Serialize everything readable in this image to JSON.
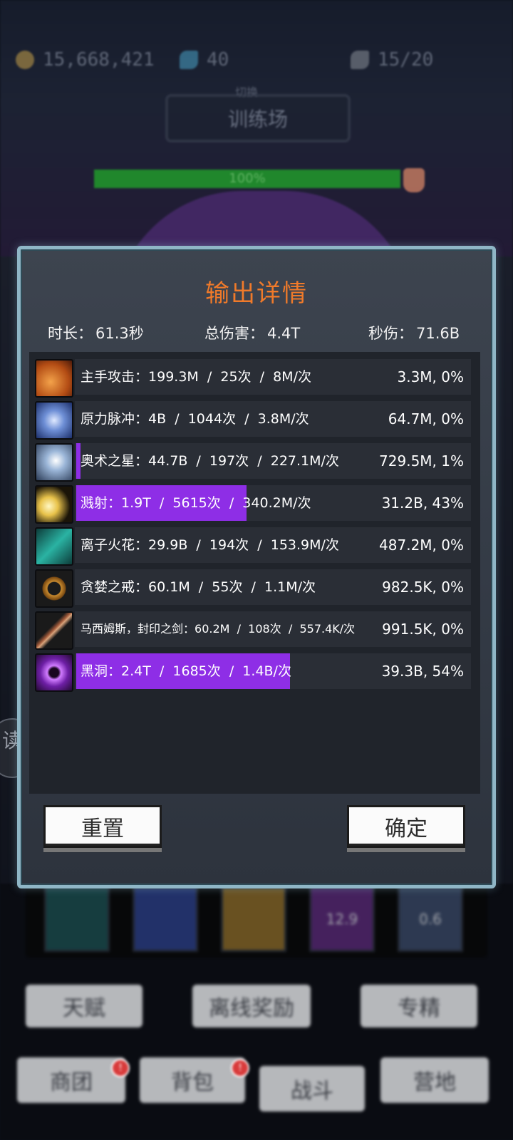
{
  "resources": {
    "gold": "15,668,421",
    "gems": "40",
    "stamina": "15/20"
  },
  "stage": {
    "sub": "切换",
    "name": "训练场",
    "boss_hp_text": "100%",
    "boss_hp_fraction": 1.0
  },
  "side_badge": "读",
  "dialog": {
    "title": "输出详情",
    "duration_label": "时长：",
    "duration_value": "61.3秒",
    "total_label": "总伤害：",
    "total_value": "4.4T",
    "dps_label": "秒伤：",
    "dps_value": "71.6B",
    "rows": [
      {
        "name": "主手攻击：",
        "stats": "199.3M  /  25次  /  8M/次",
        "dps": "3.3M, 0%",
        "share": 0.0,
        "icon": "sword-slash-icon",
        "color": "#d9732b"
      },
      {
        "name": "原力脉冲：",
        "stats": "4B  /  1044次  /  3.8M/次",
        "dps": "64.7M, 0%",
        "share": 0.0,
        "icon": "force-pulse-icon",
        "color": "#4a6fb5"
      },
      {
        "name": "奥术之星：",
        "stats": "44.7B  /  197次  /  227.1M/次",
        "dps": "729.5M, 1%",
        "share": 0.01,
        "icon": "arcane-star-icon",
        "color": "#5c7fa8"
      },
      {
        "name": "溅射：",
        "stats": "1.9T  /  5615次  /  340.2M/次",
        "dps": "31.2B, 43%",
        "share": 0.43,
        "icon": "splash-burst-icon",
        "color": "#e8c24a"
      },
      {
        "name": "离子火花：",
        "stats": "29.9B  /  194次  /  153.9M/次",
        "dps": "487.2M, 0%",
        "share": 0.0,
        "icon": "ion-spark-icon",
        "color": "#2ab3a3"
      },
      {
        "name": "贪婪之戒：",
        "stats": "60.1M  /  55次  /  1.1M/次",
        "dps": "982.5K, 0%",
        "share": 0.0,
        "icon": "greed-ring-icon",
        "color": "#c7892e"
      },
      {
        "name": "马西姆斯，封印之剑：",
        "stats": "60.2M  /  108次  /  557.4K/次",
        "dps": "991.5K, 0%",
        "share": 0.0,
        "icon": "sealed-sword-icon",
        "color": "#a05a3a"
      },
      {
        "name": "黑洞：",
        "stats": "2.4T  /  1685次  /  1.4B/次",
        "dps": "39.3B, 54%",
        "share": 0.54,
        "icon": "black-hole-icon",
        "color": "#9a3ad6"
      }
    ],
    "reset_label": "重置",
    "confirm_label": "确定"
  },
  "skill_slots": [
    "",
    "",
    "",
    "12.9",
    "0.6"
  ],
  "menu": {
    "talent": "天赋",
    "offline_reward": "离线奖励",
    "specialize": "专精"
  },
  "nav": {
    "guild": "商团",
    "bag": "背包",
    "battle": "战斗",
    "camp": "营地"
  },
  "colors": {
    "title_orange": "#f07a2a",
    "bar_purple": "#8e2ee6",
    "frame_ice": "#8fb6c6"
  }
}
